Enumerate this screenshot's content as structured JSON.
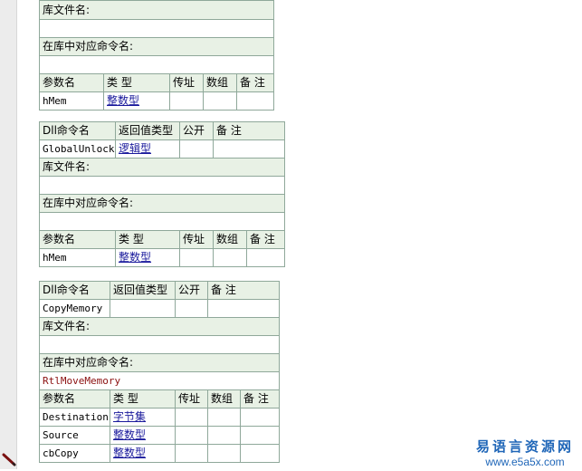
{
  "block1": {
    "lib_label": "库文件名:",
    "lib_value": "",
    "cmd_label": "在库中对应命令名:",
    "cmd_value": "",
    "param_headers": [
      "参数名",
      "类 型",
      "传址",
      "数组",
      "备 注"
    ],
    "params": [
      {
        "name": "hMem",
        "type": "整数型",
        "byref": "",
        "array": "",
        "note": ""
      }
    ]
  },
  "block2": {
    "headers": [
      "Dll命令名",
      "返回值类型",
      "公开",
      "备 注"
    ],
    "cmd_name": "GlobalUnlock",
    "return_type": "逻辑型",
    "public": "",
    "note": "",
    "lib_label": "库文件名:",
    "lib_value": "",
    "cmd_label": "在库中对应命令名:",
    "cmd_value": "",
    "param_headers": [
      "参数名",
      "类 型",
      "传址",
      "数组",
      "备 注"
    ],
    "params": [
      {
        "name": "hMem",
        "type": "整数型",
        "byref": "",
        "array": "",
        "note": ""
      }
    ]
  },
  "block3": {
    "headers": [
      "Dll命令名",
      "返回值类型",
      "公开",
      "备 注"
    ],
    "cmd_name": "CopyMemory",
    "return_type": "",
    "public": "",
    "note": "",
    "lib_label": "库文件名:",
    "lib_value": "",
    "cmd_label": "在库中对应命令名:",
    "cmd_value": "RtlMoveMemory",
    "param_headers": [
      "参数名",
      "类 型",
      "传址",
      "数组",
      "备 注"
    ],
    "params": [
      {
        "name": "Destination",
        "type": "字节集",
        "byref": "",
        "array": "",
        "note": ""
      },
      {
        "name": "Source",
        "type": "整数型",
        "byref": "",
        "array": "",
        "note": ""
      },
      {
        "name": "cbCopy",
        "type": "整数型",
        "byref": "",
        "array": "",
        "note": ""
      }
    ]
  },
  "watermark": {
    "title": "易语言资源网",
    "url": "www.e5a5x.com"
  },
  "icons": {
    "edit_marker": "pencil-icon"
  },
  "colors": {
    "header_bg": "#e8f1e5",
    "border": "#8fa89a",
    "type_link": "#1a1a9c",
    "string_value": "#8b1010",
    "watermark": "#1f66b8"
  }
}
